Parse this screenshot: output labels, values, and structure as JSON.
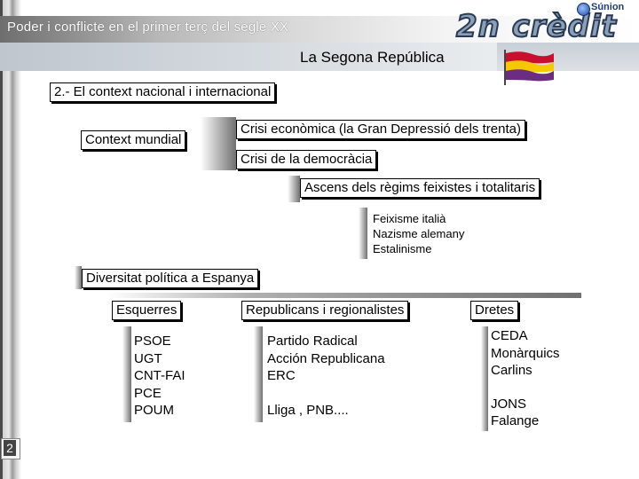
{
  "header": {
    "title": "Poder i conflicte en el primer terç del segle XX",
    "subtitle": "La Segona República",
    "credit_logo": "2n crèdit",
    "brand": "Súnion"
  },
  "section": {
    "heading": "2.- El context nacional i internacional"
  },
  "context": {
    "label": "Context mundial",
    "items": [
      "Crisi econòmica (la Gran Depressió dels trenta)",
      "Crisi de la democràcia",
      "Ascens dels règims feixistes i totalitaris"
    ],
    "regimes": [
      "Feixisme italià",
      "Nazisme alemany",
      "Estalinisme"
    ]
  },
  "spain": {
    "label": "Diversitat política a Espanya",
    "columns": [
      {
        "title": "Esquerres",
        "groups": [
          [
            "PSOE",
            "UGT",
            "CNT-FAI",
            "PCE",
            "POUM"
          ]
        ]
      },
      {
        "title": "Republicans i regionalistes",
        "groups": [
          [
            "Partido Radical",
            "Acción Republicana",
            "ERC"
          ],
          [
            "Lliga , PNB...."
          ]
        ]
      },
      {
        "title": "Dretes",
        "groups": [
          [
            "CEDA",
            "Monàrquics",
            "Carlins"
          ],
          [
            "JONS",
            "Falange"
          ]
        ]
      }
    ]
  },
  "page_number": "2",
  "colors": {
    "flag_red": "#c8102e",
    "flag_yellow": "#f6c800",
    "flag_purple": "#6b2c82",
    "logo": "#8aa0b6"
  }
}
